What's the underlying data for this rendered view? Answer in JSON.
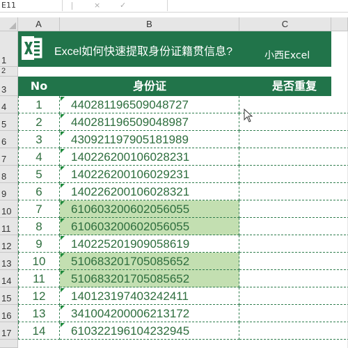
{
  "formula_bar": {
    "name_box": "E11",
    "cancel_icon": "×",
    "confirm_icon": "✓",
    "formula_value": ""
  },
  "columns": [
    "A",
    "B",
    "C"
  ],
  "rows": [
    "1",
    "2",
    "3",
    "4",
    "5",
    "6",
    "7",
    "8",
    "9",
    "10",
    "11",
    "12",
    "13",
    "14",
    "15",
    "16",
    "17"
  ],
  "title": {
    "text": "Excel如何快速提取身份证籍贯信息?",
    "author": "小西Excel",
    "band_color": "#21744a"
  },
  "table": {
    "headers": [
      "No",
      "身份证",
      "是否重复"
    ],
    "rows": [
      {
        "no": "1",
        "id": "440281196509048727",
        "dup": false
      },
      {
        "no": "2",
        "id": "440281196509048987",
        "dup": false
      },
      {
        "no": "3",
        "id": "430921197905181989",
        "dup": false
      },
      {
        "no": "4",
        "id": "140226200106028231",
        "dup": false
      },
      {
        "no": "5",
        "id": "140226200106029231",
        "dup": false
      },
      {
        "no": "6",
        "id": "140226200106028321",
        "dup": false
      },
      {
        "no": "7",
        "id": "610603200602056055",
        "dup": true
      },
      {
        "no": "8",
        "id": "610603200602056055",
        "dup": true
      },
      {
        "no": "9",
        "id": "140225201909058619",
        "dup": false
      },
      {
        "no": "10",
        "id": "510683201705085652",
        "dup": true
      },
      {
        "no": "11",
        "id": "510683201705085652",
        "dup": true
      },
      {
        "no": "12",
        "id": "140123197403242411",
        "dup": false
      },
      {
        "no": "13",
        "id": "341004200006213172",
        "dup": false
      },
      {
        "no": "14",
        "id": "610322196104232945",
        "dup": false
      }
    ],
    "highlight_color": "#c3dfb1",
    "text_color": "#2e6e3e"
  }
}
